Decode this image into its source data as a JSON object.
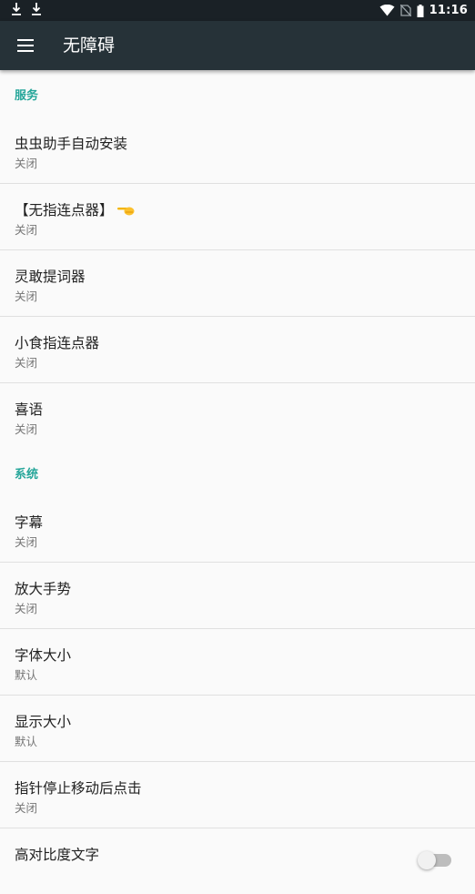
{
  "status_bar": {
    "time": "11:16",
    "icons": [
      "download-icon",
      "download-icon",
      "wifi-icon",
      "no-sim-icon",
      "battery-icon"
    ]
  },
  "toolbar": {
    "title": "无障碍",
    "menu_icon": "menu-icon"
  },
  "sections": {
    "services": {
      "header": "服务",
      "items": [
        {
          "title": "虫虫助手自动安装",
          "summary": "关闭"
        },
        {
          "title": "【无指连点器】",
          "summary": "关闭",
          "icon": "pointing-hand-icon"
        },
        {
          "title": "灵敢提词器",
          "summary": "关闭"
        },
        {
          "title": "小食指连点器",
          "summary": "关闭"
        },
        {
          "title": "喜语",
          "summary": "关闭"
        }
      ]
    },
    "system": {
      "header": "系统",
      "items": [
        {
          "title": "字幕",
          "summary": "关闭"
        },
        {
          "title": "放大手势",
          "summary": "关闭"
        },
        {
          "title": "字体大小",
          "summary": "默认"
        },
        {
          "title": "显示大小",
          "summary": "默认"
        },
        {
          "title": "指针停止移动后点击",
          "summary": "关闭"
        },
        {
          "title": "高对比度文字",
          "toggle_on": false
        }
      ]
    }
  },
  "colors": {
    "toolbar": "#263238",
    "status_bar": "#1a2126",
    "accent": "#26a69a",
    "background": "#fafafa"
  }
}
